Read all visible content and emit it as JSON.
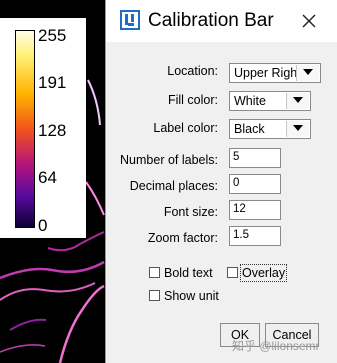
{
  "image": {
    "calibration_bar": {
      "labels": [
        "255",
        "191",
        "128",
        "64",
        "0"
      ]
    }
  },
  "dialog": {
    "title": "Calibration Bar",
    "fields": {
      "location": {
        "label": "Location:",
        "value": "Upper Righ"
      },
      "fill_color": {
        "label": "Fill color:",
        "value": "White"
      },
      "label_color": {
        "label": "Label color:",
        "value": "Black"
      },
      "number_of_labels": {
        "label": "Number of labels:",
        "value": "5"
      },
      "decimal_places": {
        "label": "Decimal places:",
        "value": "0"
      },
      "font_size": {
        "label": "Font size:",
        "value": "12"
      },
      "zoom_factor": {
        "label": "Zoom factor:",
        "value": "1.5"
      }
    },
    "checkboxes": {
      "bold_text": {
        "label": "Bold text",
        "checked": false
      },
      "overlay": {
        "label": "Overlay",
        "checked": false
      },
      "show_unit": {
        "label": "Show unit",
        "checked": false
      }
    },
    "buttons": {
      "ok": "OK",
      "cancel": "Cancel"
    }
  },
  "watermark": "知乎 @lilonsemr"
}
